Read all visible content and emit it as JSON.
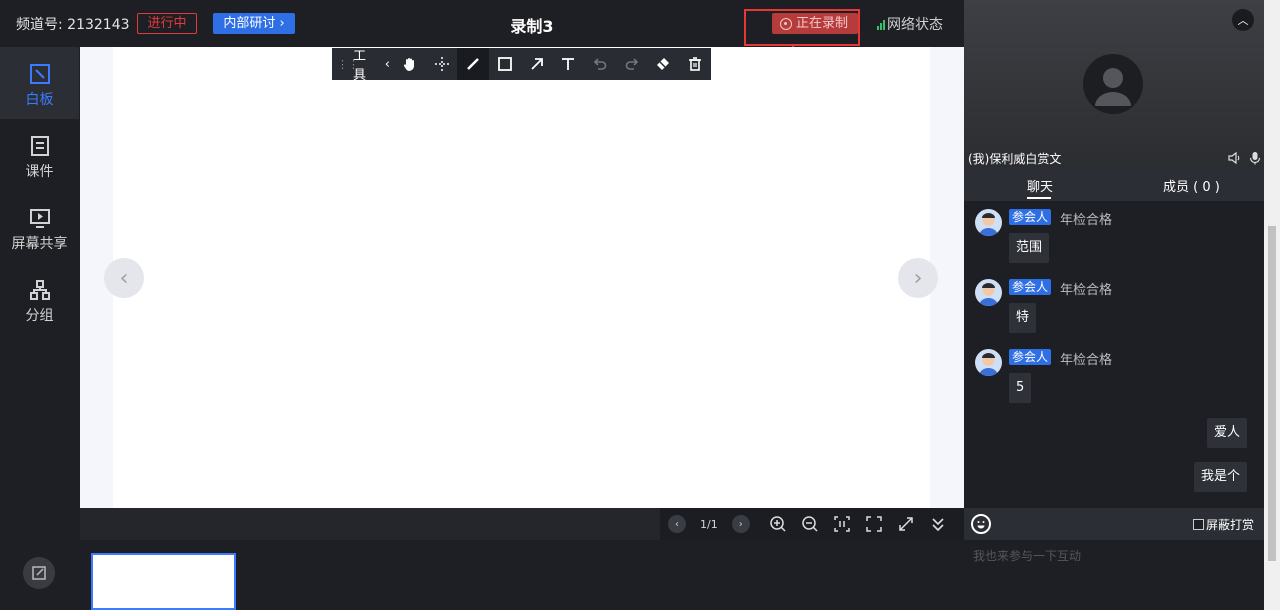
{
  "header": {
    "channel": "频道号: 2132143",
    "live_status": "进行中",
    "meeting_button": "内部研讨 ›",
    "title": "录制3",
    "recording": "正在录制",
    "network": "网络状态"
  },
  "sidebar": {
    "items": [
      {
        "label": "白板",
        "icon": "whiteboard-icon"
      },
      {
        "label": "课件",
        "icon": "courseware-icon"
      },
      {
        "label": "屏幕共享",
        "icon": "screen-share-icon"
      },
      {
        "label": "分组",
        "icon": "group-icon"
      }
    ]
  },
  "toolbar": {
    "label": "工具",
    "tools": [
      "hand-icon",
      "move-icon",
      "pen-icon",
      "rectangle-icon",
      "arrow-icon",
      "text-icon",
      "undo-icon",
      "redo-icon",
      "eraser-icon",
      "delete-icon"
    ]
  },
  "board_controls": {
    "page": "1/1"
  },
  "video": {
    "name": "(我)保利威白赏文"
  },
  "tabs": {
    "chat": "聊天",
    "members": "成员 ( 0 )"
  },
  "messages": [
    {
      "role": "参会人",
      "sender": "年检合格",
      "text": "范围"
    },
    {
      "role": "参会人",
      "sender": "年检合格",
      "text": "特"
    },
    {
      "role": "参会人",
      "sender": "年检合格",
      "text": "5"
    }
  ],
  "my_messages": [
    "爱人",
    "我是个"
  ],
  "chat_footer": {
    "block_reward": "屏蔽打赏",
    "input_placeholder": "我也来参与一下互动"
  },
  "colors": {
    "accent": "#2f6fe6",
    "recording": "#e53935",
    "live": "#e23a3a",
    "active_nav": "#3a7bff"
  }
}
